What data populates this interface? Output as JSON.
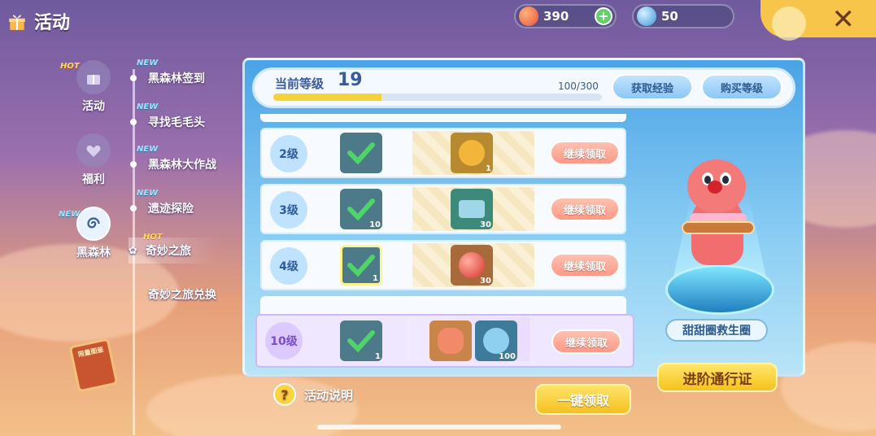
{
  "header": {
    "title": "活动",
    "currency_coins": "390",
    "currency_gems": "50",
    "coin_color": "#e8553a",
    "gem_color": "#5ab4f0"
  },
  "left_nav": [
    {
      "label": "活动",
      "badge": "HOT"
    },
    {
      "label": "福利",
      "badge": ""
    },
    {
      "label": "黑森林",
      "badge": "NEW"
    }
  ],
  "sub_nav": [
    {
      "label": "黑森林签到",
      "badge": "NEW"
    },
    {
      "label": "寻找毛毛头",
      "badge": "NEW"
    },
    {
      "label": "黑森林大作战",
      "badge": "NEW"
    },
    {
      "label": "遗迹探险",
      "badge": "NEW"
    },
    {
      "label": "奇妙之旅",
      "badge": "HOT",
      "active": true
    },
    {
      "label": "奇妙之旅兑换",
      "badge": ""
    }
  ],
  "level": {
    "label": "当前等级",
    "value": "19",
    "xp_text": "100/300",
    "xp_fraction": 0.33,
    "get_exp_btn": "获取经验",
    "buy_level_btn": "购买等级"
  },
  "rows": [
    {
      "level": "2级",
      "free_qty": "",
      "paid_qty": "1",
      "claim": "继续领取"
    },
    {
      "level": "3级",
      "free_qty": "10",
      "paid_qty": "30",
      "claim": "继续领取"
    },
    {
      "level": "4级",
      "free_qty": "1",
      "paid_qty": "30",
      "claim": "继续领取"
    },
    {
      "level": "10级",
      "free_qty": "1",
      "paid_qty": "100",
      "claim": "继续领取"
    }
  ],
  "reward": {
    "name": "甜甜圈救生圈",
    "advance_btn": "进阶通行证"
  },
  "footer": {
    "help_label": "活动说明",
    "help_icon": "?",
    "one_key_btn": "一键领取"
  },
  "book_label": "限量图鉴"
}
